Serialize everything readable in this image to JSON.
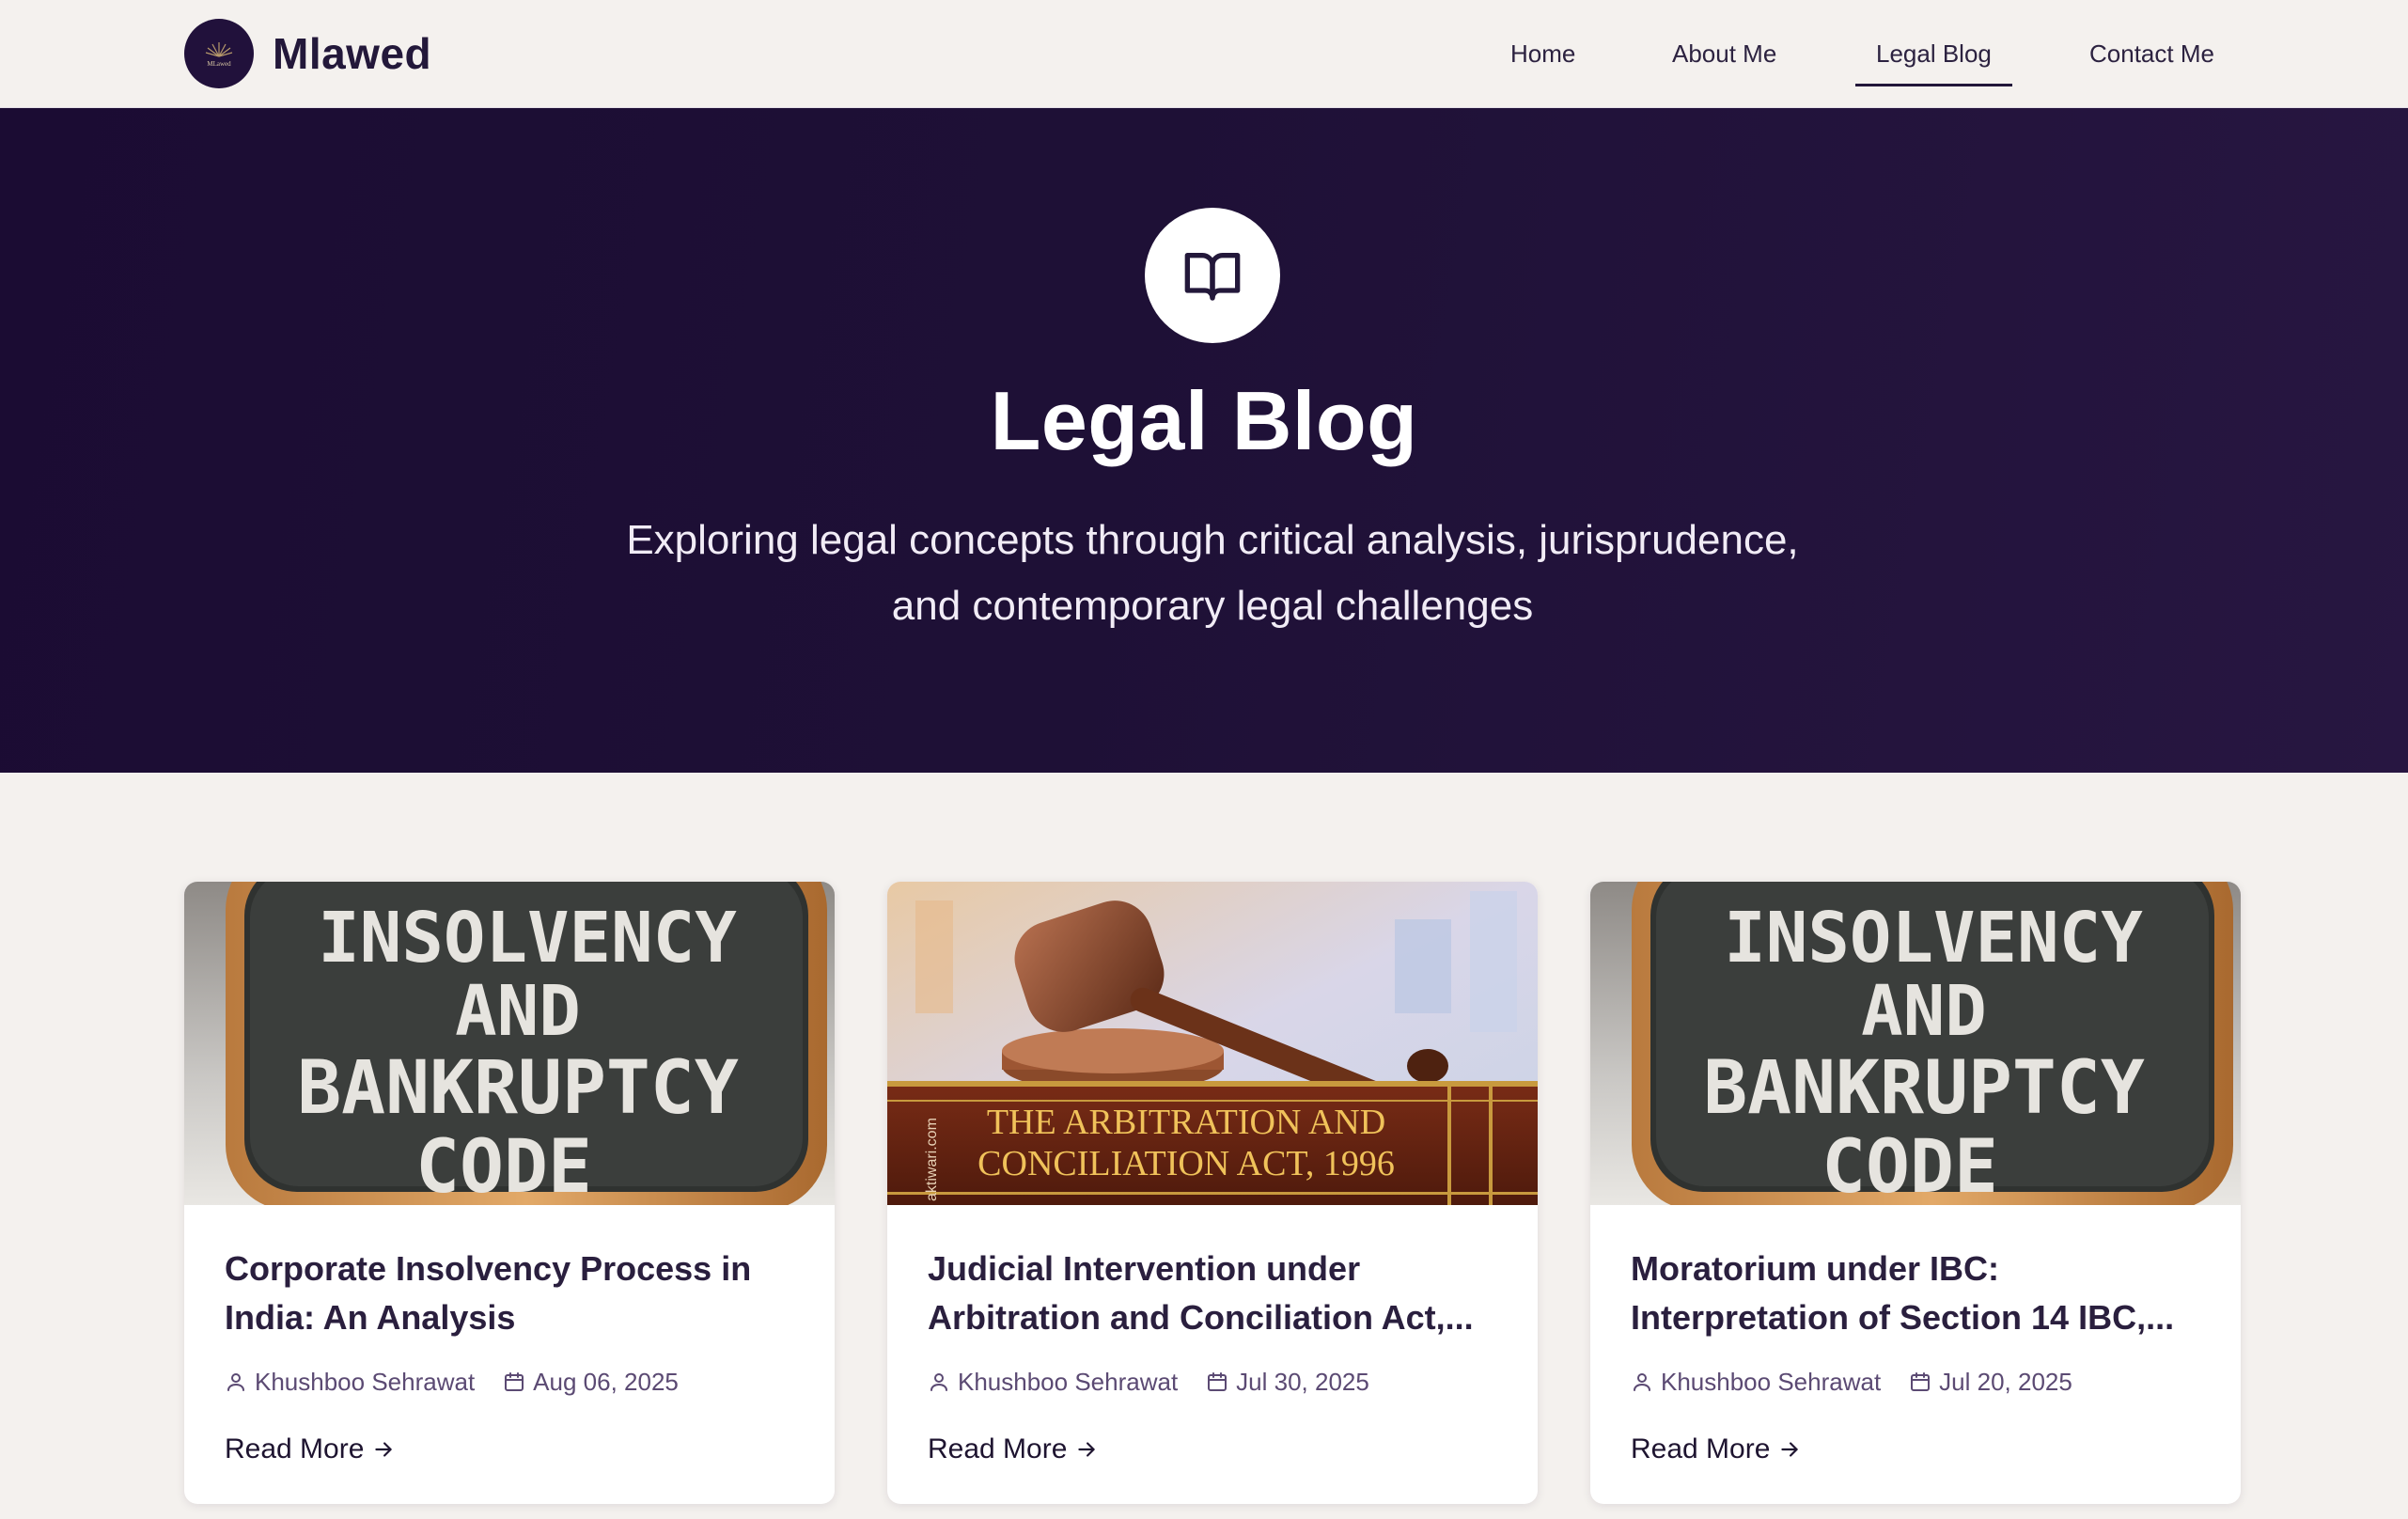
{
  "brand": {
    "name": "Mlawed",
    "logo_text": "MLawed"
  },
  "nav": {
    "items": [
      {
        "label": "Home",
        "active": false
      },
      {
        "label": "About Me",
        "active": false
      },
      {
        "label": "Legal Blog",
        "active": true
      },
      {
        "label": "Contact Me",
        "active": false
      }
    ]
  },
  "hero": {
    "icon": "open-book-icon",
    "title": "Legal Blog",
    "subtitle_line1": "Exploring legal concepts through critical analysis, jurisprudence,",
    "subtitle_line2": "and contemporary legal challenges"
  },
  "cards": [
    {
      "image_text": [
        "INSOLVENCY",
        "AND",
        "BANKRUPTCY",
        "CODE"
      ],
      "title": "Corporate Insolvency Process in India: An Analysis",
      "author": "Khushboo Sehrawat",
      "date": "Aug 06, 2025",
      "cta": "Read More"
    },
    {
      "image_text": [
        "THE ARBITRATION AND",
        "CONCILIATION ACT, 1996"
      ],
      "image_watermark": "aktiwari.com",
      "title": "Judicial Intervention under Arbitration and Conciliation Act,...",
      "author": "Khushboo Sehrawat",
      "date": "Jul 30, 2025",
      "cta": "Read More"
    },
    {
      "image_text": [
        "INSOLVENCY",
        "AND",
        "BANKRUPTCY",
        "CODE"
      ],
      "title": "Moratorium under IBC: Interpretation of Section 14 IBC,...",
      "author": "Khushboo Sehrawat",
      "date": "Jul 20, 2025",
      "cta": "Read More"
    }
  ],
  "colors": {
    "hero_bg": "#1e1036",
    "page_bg": "#f4f1ee",
    "text_dark": "#241838",
    "meta_text": "#5b4a73"
  }
}
